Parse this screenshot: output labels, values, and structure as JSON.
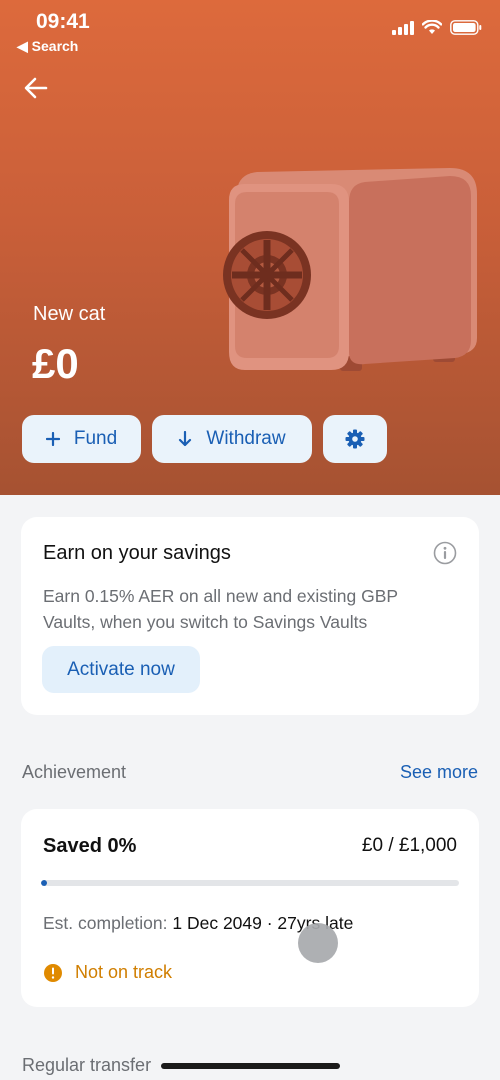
{
  "status_bar": {
    "time": "09:41",
    "back_app": "◀ Search"
  },
  "vault": {
    "name": "New cat",
    "amount": "£0"
  },
  "actions": {
    "fund_label": "Fund",
    "withdraw_label": "Withdraw"
  },
  "savings_card": {
    "title": "Earn on your savings",
    "body": "Earn 0.15% AER on all new and existing GBP Vaults, when you switch to Savings Vaults",
    "cta": "Activate now"
  },
  "achievement": {
    "section_label": "Achievement",
    "see_more": "See more",
    "saved_label": "Saved 0%",
    "amount": "£0 / £1,000",
    "progress_percent": 0,
    "est_label": "Est. completion:",
    "est_value": "1 Dec 2049 · 27yrs late",
    "status": "Not on track"
  },
  "regular_transfer_label": "Regular transfer",
  "colors": {
    "accent": "#1a5fb4",
    "hero_top": "#dd6a3c",
    "warning": "#d07e00"
  }
}
